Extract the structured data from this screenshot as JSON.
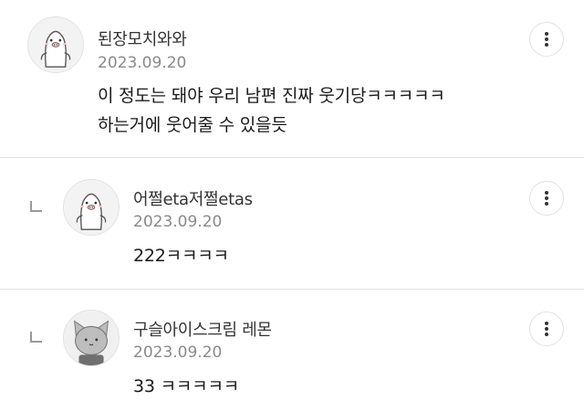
{
  "comments": [
    {
      "nickname": "된장모치와와",
      "date": "2023.09.20",
      "lines": [
        "이 정도는 돼야 우리 남편 진짜 웃기당ㅋㅋㅋㅋㅋ",
        "하는거에 웃어줄 수 있을듯"
      ],
      "avatar_icon": "penguin-avatar-icon"
    },
    {
      "nickname": "어쩔eta저쩔etas",
      "date": "2023.09.20",
      "lines": [
        "222ㅋㅋㅋㅋ"
      ],
      "avatar_icon": "penguin-avatar-icon",
      "is_reply": true
    },
    {
      "nickname": "구슬아이스크림 레몬",
      "date": "2023.09.20",
      "lines": [
        "33 ㅋㅋㅋㅋㅋ"
      ],
      "avatar_icon": "cat-avatar-icon",
      "is_reply": true
    }
  ],
  "more_button_icon": "more-vertical-icon",
  "reply_indicator_icon": "reply-arrow-icon",
  "colors": {
    "text": "#1a1a1a",
    "date": "#8a8a8a",
    "divider": "#e4e4e4"
  }
}
